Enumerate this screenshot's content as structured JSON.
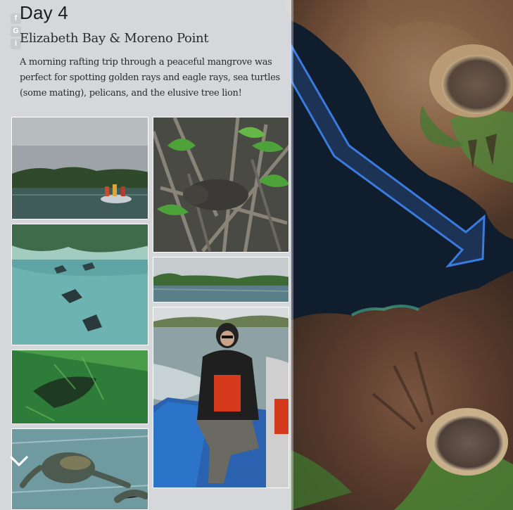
{
  "story": {
    "title": "Day 4",
    "subtitle": "Elizabeth Bay & Moreno Point",
    "description": "A morning rafting trip through a peaceful mangrove was perfect for spotting golden rays and eagle rays, sea turtles (some mating), pelicans, and the elusive tree lion!"
  },
  "share_icons": [
    "facebook-icon",
    "google-plus-icon",
    "info-icon"
  ],
  "share_glyphs": {
    "facebook": "f",
    "google_plus": "G",
    "info": "i"
  },
  "photos": [
    {
      "name": "photo-raft-in-mangrove",
      "alt": "Rafting in mangrove"
    },
    {
      "name": "photo-sea-lion-in-mangrove",
      "alt": "Sea lion in mangrove"
    },
    {
      "name": "photo-eagle-rays",
      "alt": "Eagle rays in water"
    },
    {
      "name": "photo-mangrove-lagoon",
      "alt": "Mangrove lagoon"
    },
    {
      "name": "photo-golden-ray",
      "alt": "Golden ray"
    },
    {
      "name": "photo-traveler-on-raft",
      "alt": "Traveler on raft"
    },
    {
      "name": "photo-sea-turtles",
      "alt": "Sea turtles"
    }
  ],
  "colors": {
    "ocean": "#0f1d2c",
    "route_arrow": "#3a7be0",
    "panel": "#e4e5e8"
  }
}
